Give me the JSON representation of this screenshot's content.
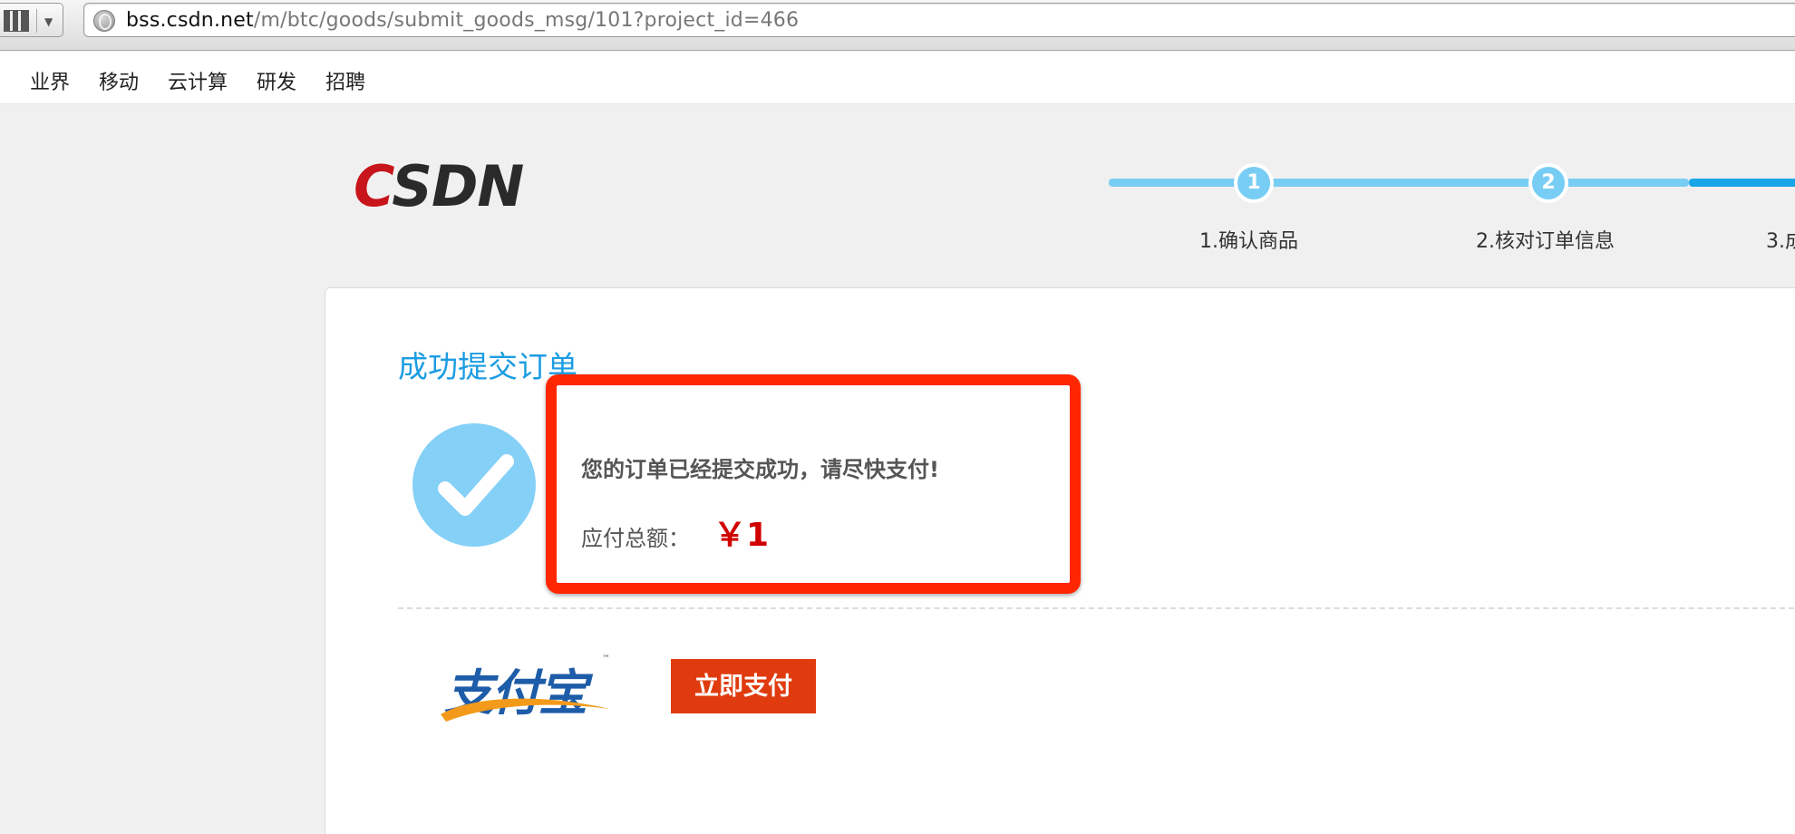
{
  "browser": {
    "url_domain": "bss.csdn.net",
    "url_path": "/m/btc/goods/submit_goods_msg/101?project_id=466"
  },
  "topnav": {
    "items": [
      {
        "label": "业界"
      },
      {
        "label": "移动"
      },
      {
        "label": "云计算"
      },
      {
        "label": "研发"
      },
      {
        "label": "招聘"
      }
    ]
  },
  "logo": {
    "c": "C",
    "rest": "SDN"
  },
  "steps": [
    {
      "number": "1",
      "label": "1.确认商品"
    },
    {
      "number": "2",
      "label": "2.核对订单信息"
    },
    {
      "number": "3",
      "label": "3.成"
    }
  ],
  "card": {
    "title": "成功提交订单",
    "message": "您的订单已经提交成功，请尽快支付!",
    "amount_label": "应付总额：",
    "amount_value": "￥1",
    "alipay_text": "支付宝",
    "alipay_tm": "™",
    "pay_button": "立即支付"
  },
  "colors": {
    "accent": "#1b9ce2",
    "highlight": "#ff2600",
    "pay_button": "#e03b0e",
    "amount": "#d10000"
  }
}
